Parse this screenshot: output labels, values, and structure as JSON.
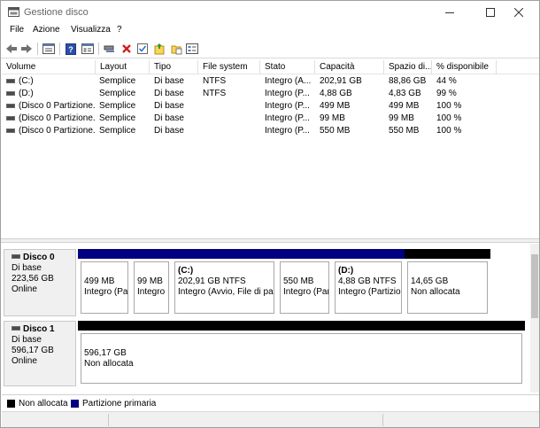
{
  "window": {
    "title": "Gestione disco"
  },
  "menu": {
    "items": [
      "File",
      "Azione",
      "Visualizza",
      "?"
    ]
  },
  "toolbar": {
    "buttons": [
      "back-icon",
      "forward-icon",
      "list-view-icon",
      "properties-icon",
      "help-icon",
      "console-tree-icon",
      "connect-icon",
      "delete-icon",
      "check-icon",
      "import-icon",
      "open-folder-icon",
      "details-icon"
    ]
  },
  "volumes": {
    "headers": [
      "Volume",
      "Layout",
      "Tipo",
      "File system",
      "Stato",
      "Capacità",
      "Spazio di...",
      "% disponibile"
    ],
    "rows": [
      {
        "volume": "(C:)",
        "layout": "Semplice",
        "tipo": "Di base",
        "fs": "NTFS",
        "stato": "Integro (A...",
        "capacita": "202,91 GB",
        "spazio": "88,86 GB",
        "disp": "44 %"
      },
      {
        "volume": "(D:)",
        "layout": "Semplice",
        "tipo": "Di base",
        "fs": "NTFS",
        "stato": "Integro (P...",
        "capacita": "4,88 GB",
        "spazio": "4,83 GB",
        "disp": "99 %"
      },
      {
        "volume": "(Disco 0 Partizione...",
        "layout": "Semplice",
        "tipo": "Di base",
        "fs": "",
        "stato": "Integro (P...",
        "capacita": "499 MB",
        "spazio": "499 MB",
        "disp": "100 %"
      },
      {
        "volume": "(Disco 0 Partizione...",
        "layout": "Semplice",
        "tipo": "Di base",
        "fs": "",
        "stato": "Integro (P...",
        "capacita": "99 MB",
        "spazio": "99 MB",
        "disp": "100 %"
      },
      {
        "volume": "(Disco 0 Partizione...",
        "layout": "Semplice",
        "tipo": "Di base",
        "fs": "",
        "stato": "Integro (P...",
        "capacita": "550 MB",
        "spazio": "550 MB",
        "disp": "100 %"
      }
    ]
  },
  "disks": [
    {
      "name": "Disco 0",
      "type": "Di base",
      "size": "223,56 GB",
      "status": "Online",
      "partitions": [
        {
          "kind": "primary",
          "name": "",
          "size": "499 MB",
          "desc": "Integro (Pa"
        },
        {
          "kind": "primary",
          "name": "",
          "size": "99 MB",
          "desc": "Integro"
        },
        {
          "kind": "primary",
          "name": "(C:)",
          "size": "202,91 GB NTFS",
          "desc": "Integro (Avvio, File di pag"
        },
        {
          "kind": "primary",
          "name": "",
          "size": "550 MB",
          "desc": "Integro (Par"
        },
        {
          "kind": "primary",
          "name": "(D:)",
          "size": "4,88 GB NTFS",
          "desc": "Integro (Partizior"
        },
        {
          "kind": "unalloc",
          "name": "",
          "size": "14,65 GB",
          "desc": "Non allocata"
        }
      ]
    },
    {
      "name": "Disco 1",
      "type": "Di base",
      "size": "596,17 GB",
      "status": "Online",
      "partitions": [
        {
          "kind": "unalloc",
          "name": "",
          "size": "596,17 GB",
          "desc": "Non allocata"
        }
      ]
    }
  ],
  "legend": {
    "items": [
      {
        "label": "Non allocata",
        "color": "#000000"
      },
      {
        "label": "Partizione primaria",
        "color": "#000080"
      }
    ]
  },
  "colors": {
    "primary_partition": "#000080",
    "unallocated": "#000000"
  }
}
